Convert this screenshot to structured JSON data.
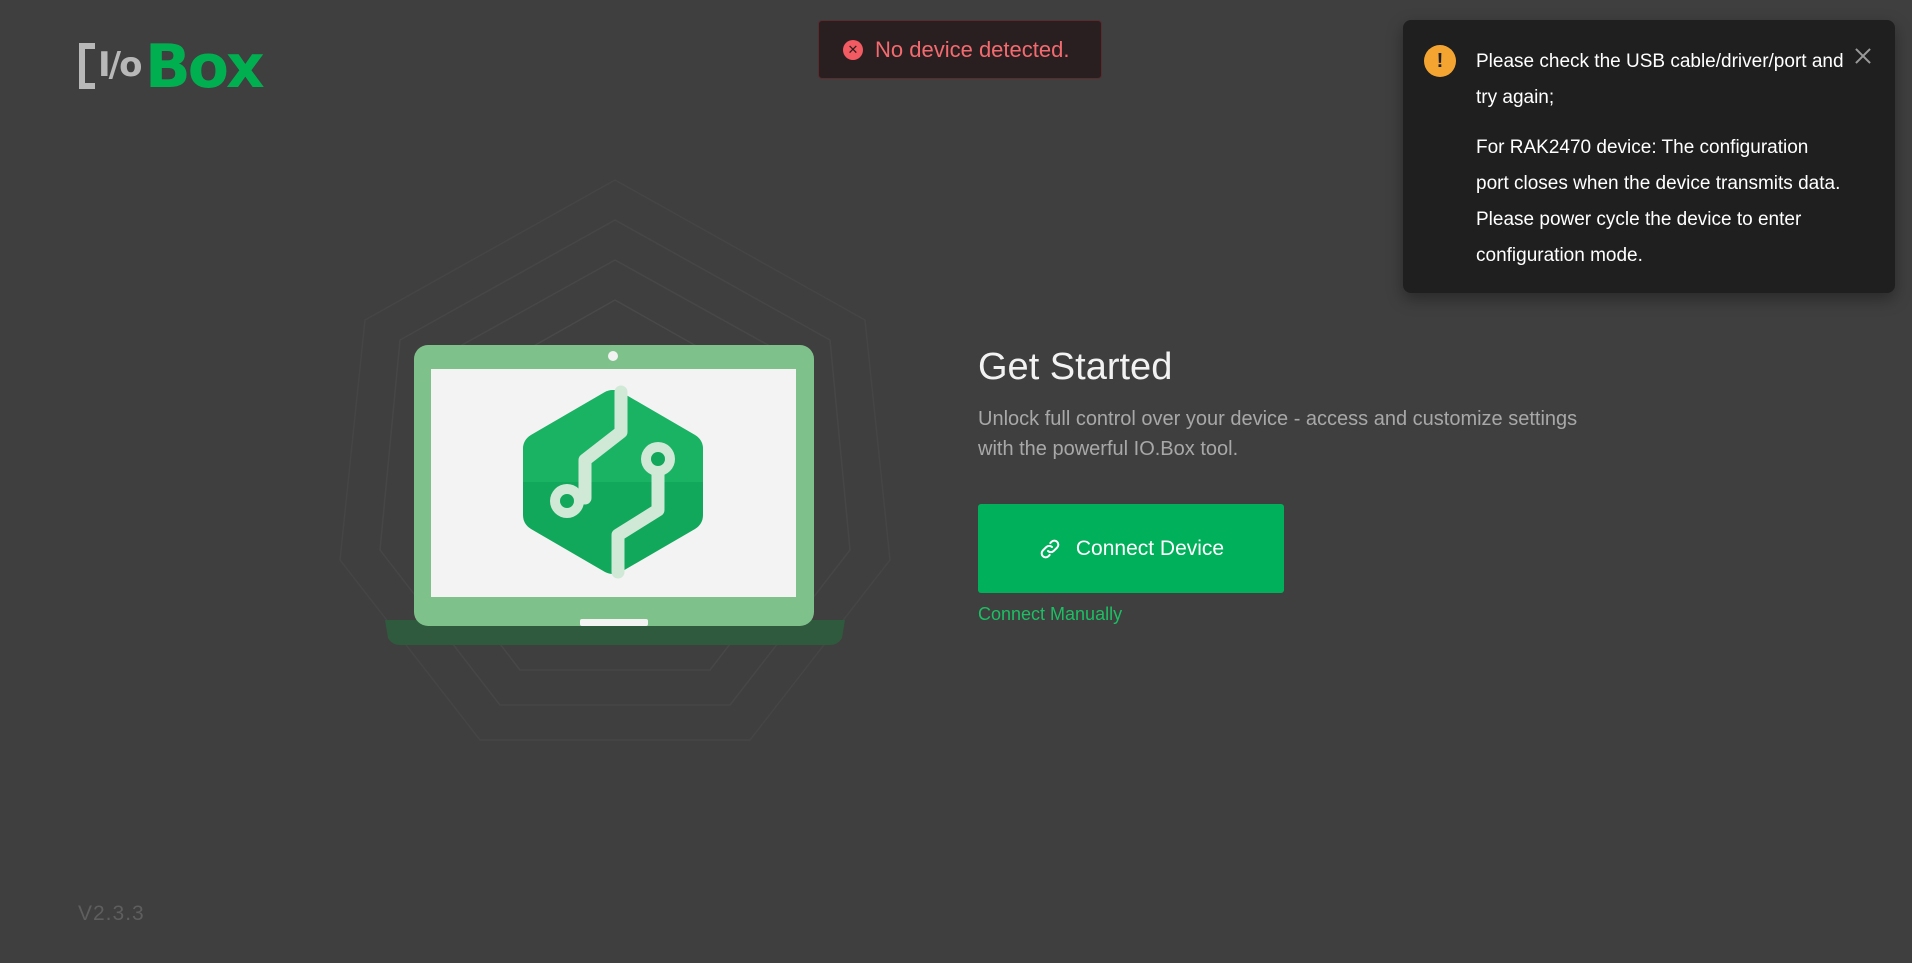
{
  "logo": {
    "io_text": "I/o",
    "brand_text": "Box"
  },
  "toast": {
    "message": "No device detected.",
    "icon": "close-circle-icon",
    "color": "#f25b61"
  },
  "notification": {
    "icon": "exclamation-circle-icon",
    "line1": "Please check the USB cable/driver/port and try again;",
    "line2": "For RAK2470 device: The configuration port closes when the device transmits data. Please power cycle the device to enter configuration mode.",
    "close_icon": "close-icon",
    "accent": "#f4a531"
  },
  "main": {
    "title": "Get Started",
    "subtitle": "Unlock full control over your device - access and customize settings with the powerful IO.Box tool.",
    "connect_button": {
      "label": "Connect Device",
      "icon": "link-icon"
    },
    "connect_manually_label": "Connect Manually"
  },
  "footer": {
    "version": "V2.3.3"
  },
  "colors": {
    "brand_green": "#00b050",
    "background": "#3f3f3f"
  }
}
